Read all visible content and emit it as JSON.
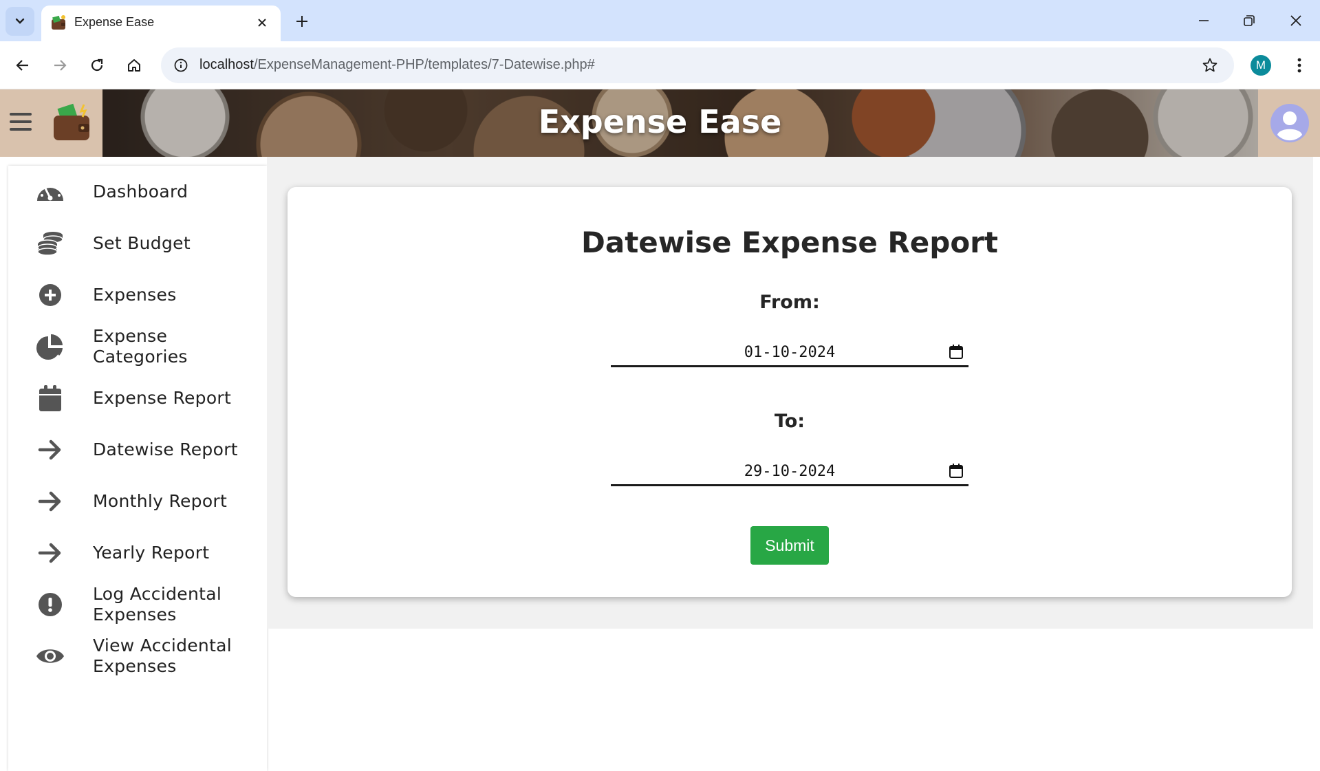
{
  "browser": {
    "tab_title": "Expense Ease",
    "url_host": "localhost",
    "url_path": "/ExpenseManagement-PHP/templates/7-Datewise.php#",
    "profile_initial": "M"
  },
  "header": {
    "app_title": "Expense Ease"
  },
  "sidebar": {
    "items": [
      {
        "label": "Dashboard",
        "icon": "gauge-icon"
      },
      {
        "label": "Set Budget",
        "icon": "coins-icon"
      },
      {
        "label": "Expenses",
        "icon": "plus-circle-icon"
      },
      {
        "label": "Expense Categories",
        "icon": "pie-chart-icon"
      },
      {
        "label": "Expense Report",
        "icon": "calendar-icon"
      },
      {
        "label": "Datewise Report",
        "icon": "arrow-right-icon"
      },
      {
        "label": "Monthly Report",
        "icon": "arrow-right-icon"
      },
      {
        "label": "Yearly Report",
        "icon": "arrow-right-icon"
      },
      {
        "label": "Log Accidental Expenses",
        "icon": "exclamation-circle-icon"
      },
      {
        "label": "View Accidental Expenses",
        "icon": "eye-icon"
      }
    ]
  },
  "main": {
    "title": "Datewise Expense Report",
    "from_label": "From:",
    "from_value": "01-10-2024",
    "to_label": "To:",
    "to_value": "29-10-2024",
    "submit_label": "Submit"
  },
  "colors": {
    "submit": "#28a745",
    "tabstrip": "#d3e3fd",
    "icon_gray": "#555555"
  }
}
